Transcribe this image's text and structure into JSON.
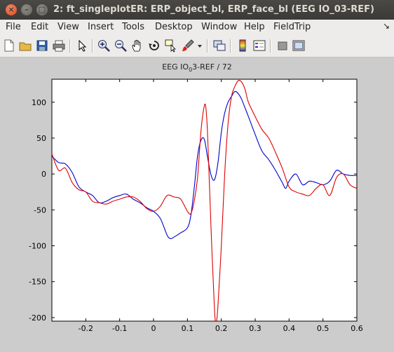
{
  "window": {
    "title": "2: ft_singleplotER: ERP_object_bl, ERP_face_bl (EEG IO_03-REF)",
    "close_glyph": "×",
    "min_glyph": "–",
    "max_glyph": "□"
  },
  "menu": {
    "file": "File",
    "edit": "Edit",
    "view": "View",
    "insert": "Insert",
    "tools": "Tools",
    "desktop": "Desktop",
    "window": "Window",
    "help": "Help",
    "fieldtrip": "FieldTrip",
    "dock_arrow": "↘"
  },
  "toolbar": {
    "icons": [
      "new-figure-icon",
      "open-icon",
      "save-icon",
      "print-icon",
      "edit-plot-arrow-icon",
      "zoom-in-icon",
      "zoom-out-icon",
      "pan-hand-icon",
      "rotate-3d-icon",
      "data-cursor-icon",
      "brush-icon",
      "brush-dropdown-icon",
      "link-plot-icon",
      "colorbar-icon",
      "legend-icon",
      "hide-plot-tools-icon",
      "show-plot-tools-icon"
    ]
  },
  "plot": {
    "title_main": "EEG IO",
    "title_sub": "0",
    "title_rest": "3-REF / 72"
  },
  "chart_data": {
    "type": "line",
    "title": "EEG IO_03-REF / 72",
    "xlim": [
      -0.3,
      0.6
    ],
    "ylim": [
      -205,
      132
    ],
    "xticks": [
      -0.2,
      -0.1,
      0,
      0.1,
      0.2,
      0.3,
      0.4,
      0.5,
      0.6
    ],
    "xtick_labels": [
      "-0.2",
      "-0.1",
      "0",
      "0.1",
      "0.2",
      "0.3",
      "0.4",
      "0.5",
      "0.6"
    ],
    "yticks": [
      -200,
      -150,
      -100,
      -50,
      0,
      50,
      100
    ],
    "ytick_labels": [
      "-200",
      "-150",
      "-100",
      "-50",
      "0",
      "50",
      "100"
    ],
    "grid": false,
    "series": [
      {
        "color": "#0000cc",
        "x": [
          -0.3,
          -0.28,
          -0.26,
          -0.24,
          -0.22,
          -0.2,
          -0.18,
          -0.16,
          -0.14,
          -0.12,
          -0.1,
          -0.08,
          -0.06,
          -0.04,
          -0.02,
          0,
          0.02,
          0.04,
          0.05,
          0.06,
          0.08,
          0.1,
          0.11,
          0.12,
          0.13,
          0.14,
          0.15,
          0.16,
          0.17,
          0.18,
          0.19,
          0.2,
          0.21,
          0.22,
          0.23,
          0.24,
          0.25,
          0.26,
          0.27,
          0.28,
          0.3,
          0.32,
          0.34,
          0.36,
          0.38,
          0.39,
          0.4,
          0.42,
          0.44,
          0.46,
          0.48,
          0.5,
          0.52,
          0.54,
          0.56,
          0.58,
          0.6
        ],
        "y": [
          25,
          16,
          14,
          2,
          -18,
          -25,
          -30,
          -40,
          -38,
          -33,
          -30,
          -28,
          -35,
          -40,
          -47,
          -52,
          -62,
          -85,
          -90,
          -88,
          -82,
          -75,
          -58,
          -20,
          25,
          47,
          48,
          22,
          -2,
          -8,
          15,
          58,
          85,
          100,
          108,
          115,
          112,
          104,
          92,
          80,
          55,
          32,
          20,
          5,
          -12,
          -20,
          -10,
          0,
          -15,
          -10,
          -12,
          -15,
          -10,
          5,
          0,
          -2,
          -2
        ]
      },
      {
        "color": "#dd0000",
        "x": [
          -0.3,
          -0.28,
          -0.26,
          -0.24,
          -0.22,
          -0.2,
          -0.18,
          -0.16,
          -0.14,
          -0.12,
          -0.1,
          -0.08,
          -0.06,
          -0.04,
          -0.02,
          0,
          0.02,
          0.04,
          0.06,
          0.08,
          0.1,
          0.11,
          0.12,
          0.13,
          0.14,
          0.15,
          0.155,
          0.16,
          0.17,
          0.18,
          0.185,
          0.19,
          0.2,
          0.21,
          0.22,
          0.23,
          0.24,
          0.25,
          0.26,
          0.27,
          0.28,
          0.3,
          0.32,
          0.34,
          0.36,
          0.38,
          0.4,
          0.42,
          0.44,
          0.46,
          0.48,
          0.5,
          0.52,
          0.54,
          0.56,
          0.58,
          0.6
        ],
        "y": [
          28,
          5,
          8,
          -12,
          -22,
          -25,
          -38,
          -40,
          -42,
          -38,
          -35,
          -32,
          -32,
          -38,
          -48,
          -52,
          -45,
          -30,
          -32,
          -35,
          -52,
          -55,
          -38,
          -5,
          60,
          95,
          90,
          50,
          -80,
          -190,
          -205,
          -185,
          -100,
          0,
          70,
          108,
          122,
          130,
          128,
          118,
          100,
          80,
          62,
          50,
          30,
          8,
          -18,
          -25,
          -28,
          -30,
          -20,
          -15,
          -30,
          -5,
          0,
          -15,
          -20
        ]
      }
    ]
  }
}
